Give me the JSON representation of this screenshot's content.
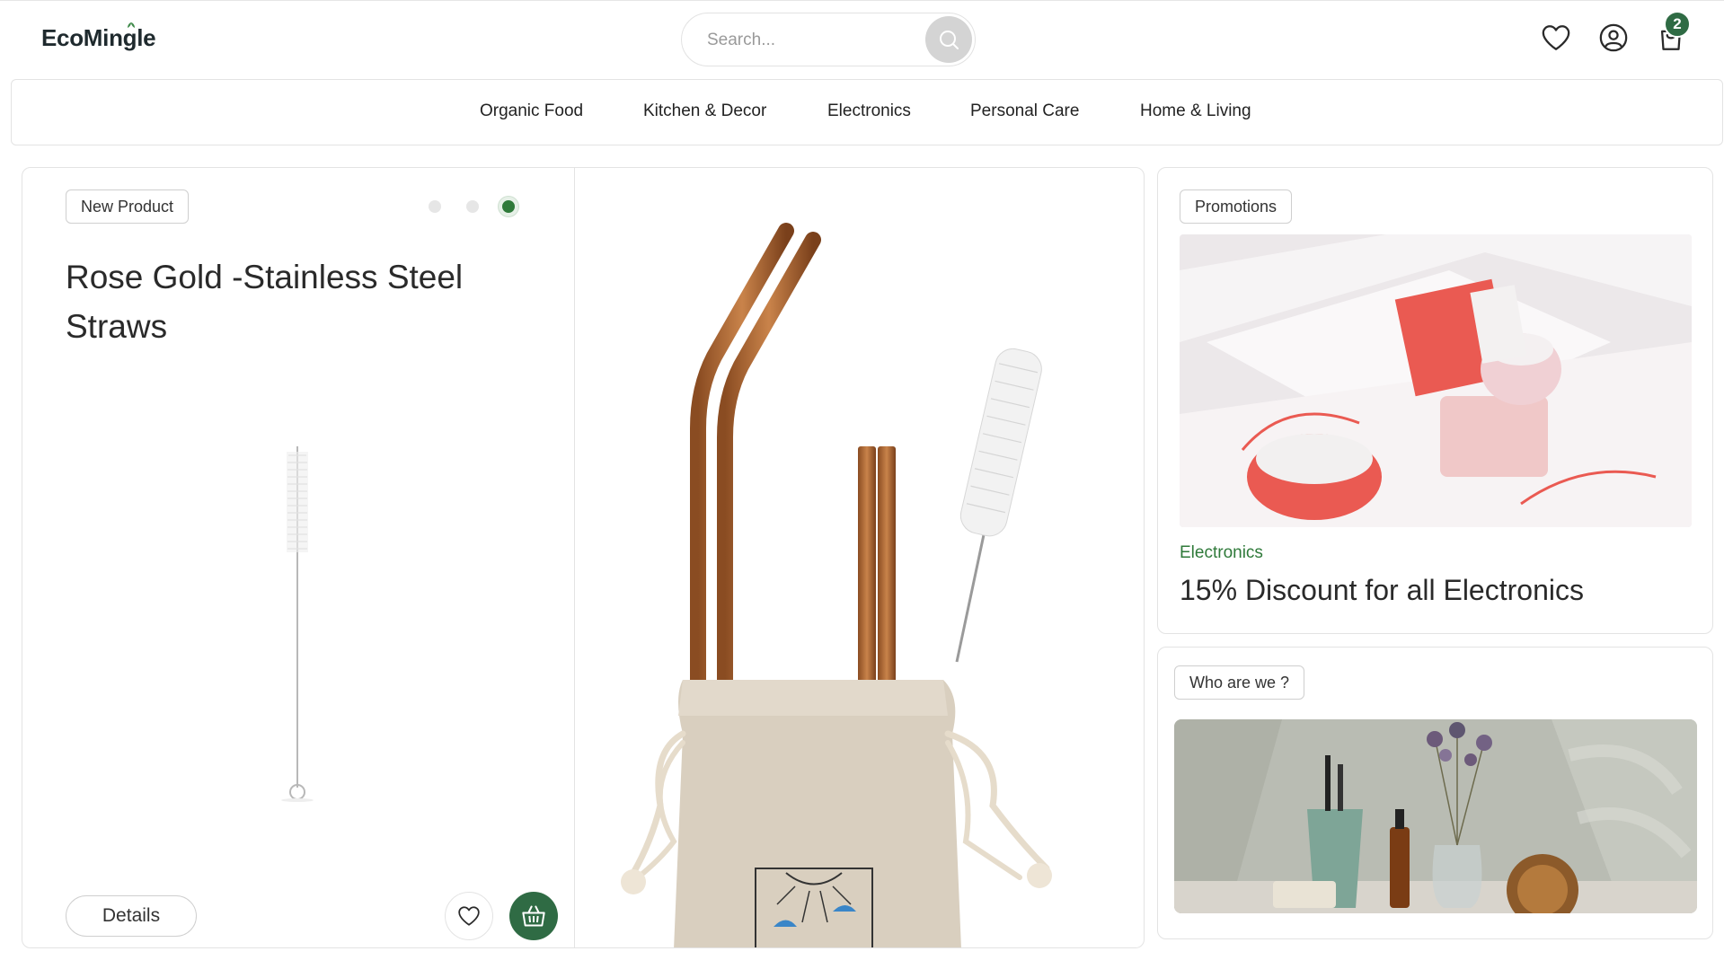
{
  "header": {
    "logo": "EcoMingle",
    "search_placeholder": "Search...",
    "cart_count": "2"
  },
  "nav": {
    "items": [
      {
        "label": "Organic Food"
      },
      {
        "label": "Kitchen & Decor"
      },
      {
        "label": "Electronics"
      },
      {
        "label": "Personal Care"
      },
      {
        "label": "Home & Living"
      }
    ]
  },
  "product": {
    "tag": "New Product",
    "title": "Rose Gold -Stainless Steel Straws",
    "details_label": "Details",
    "slide_count": 3,
    "active_slide": 3
  },
  "promotions": {
    "tag": "Promotions",
    "category": "Electronics",
    "title": "15% Discount for all Electronics"
  },
  "who": {
    "tag": "Who are we ?"
  },
  "colors": {
    "accent": "#2f6b44",
    "category": "#2f7a3a"
  }
}
